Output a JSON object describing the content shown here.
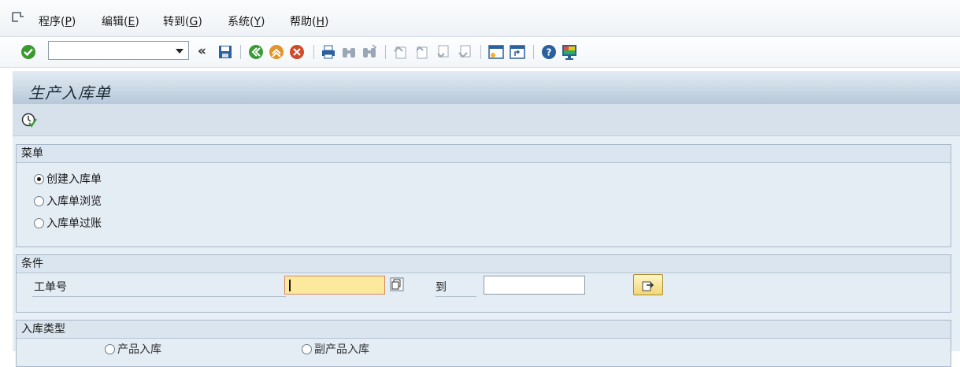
{
  "menubar": {
    "items": [
      {
        "label": "程序(",
        "key": "P",
        "tail": ")"
      },
      {
        "label": "编辑(",
        "key": "E",
        "tail": ")"
      },
      {
        "label": "转到(",
        "key": "G",
        "tail": ")"
      },
      {
        "label": "系统(",
        "key": "Y",
        "tail": ")"
      },
      {
        "label": "帮助(",
        "key": "H",
        "tail": ")"
      }
    ]
  },
  "toolbar": {
    "command_value": "",
    "icons": [
      "enter-check-icon",
      "save-icon",
      "back-icon",
      "exit-icon",
      "cancel-icon",
      "print-icon",
      "find-icon",
      "find-next-icon",
      "first-page-icon",
      "prev-page-icon",
      "next-page-icon",
      "last-page-icon",
      "new-session-icon",
      "shortcut-icon",
      "help-icon",
      "layout-menu-icon"
    ],
    "colors": {
      "check": "#3a9a2f",
      "back": "#3d9a3a",
      "exit": "#e2932b",
      "cancel": "#cf4a2c",
      "blue": "#2b5f9e"
    }
  },
  "page": {
    "title": "生产入库单"
  },
  "menu_group": {
    "title": "菜单",
    "options": [
      {
        "label": "创建入库单",
        "selected": true
      },
      {
        "label": "入库单浏览",
        "selected": false
      },
      {
        "label": "入库单过账",
        "selected": false
      }
    ]
  },
  "condition_group": {
    "title": "条件",
    "field_label": "工单号",
    "low_value": "",
    "to_label": "到",
    "high_value": ""
  },
  "type_group": {
    "title": "入库类型",
    "options": [
      {
        "label": "产品入库",
        "selected": false
      },
      {
        "label": "副产品入库",
        "selected": false
      }
    ]
  }
}
